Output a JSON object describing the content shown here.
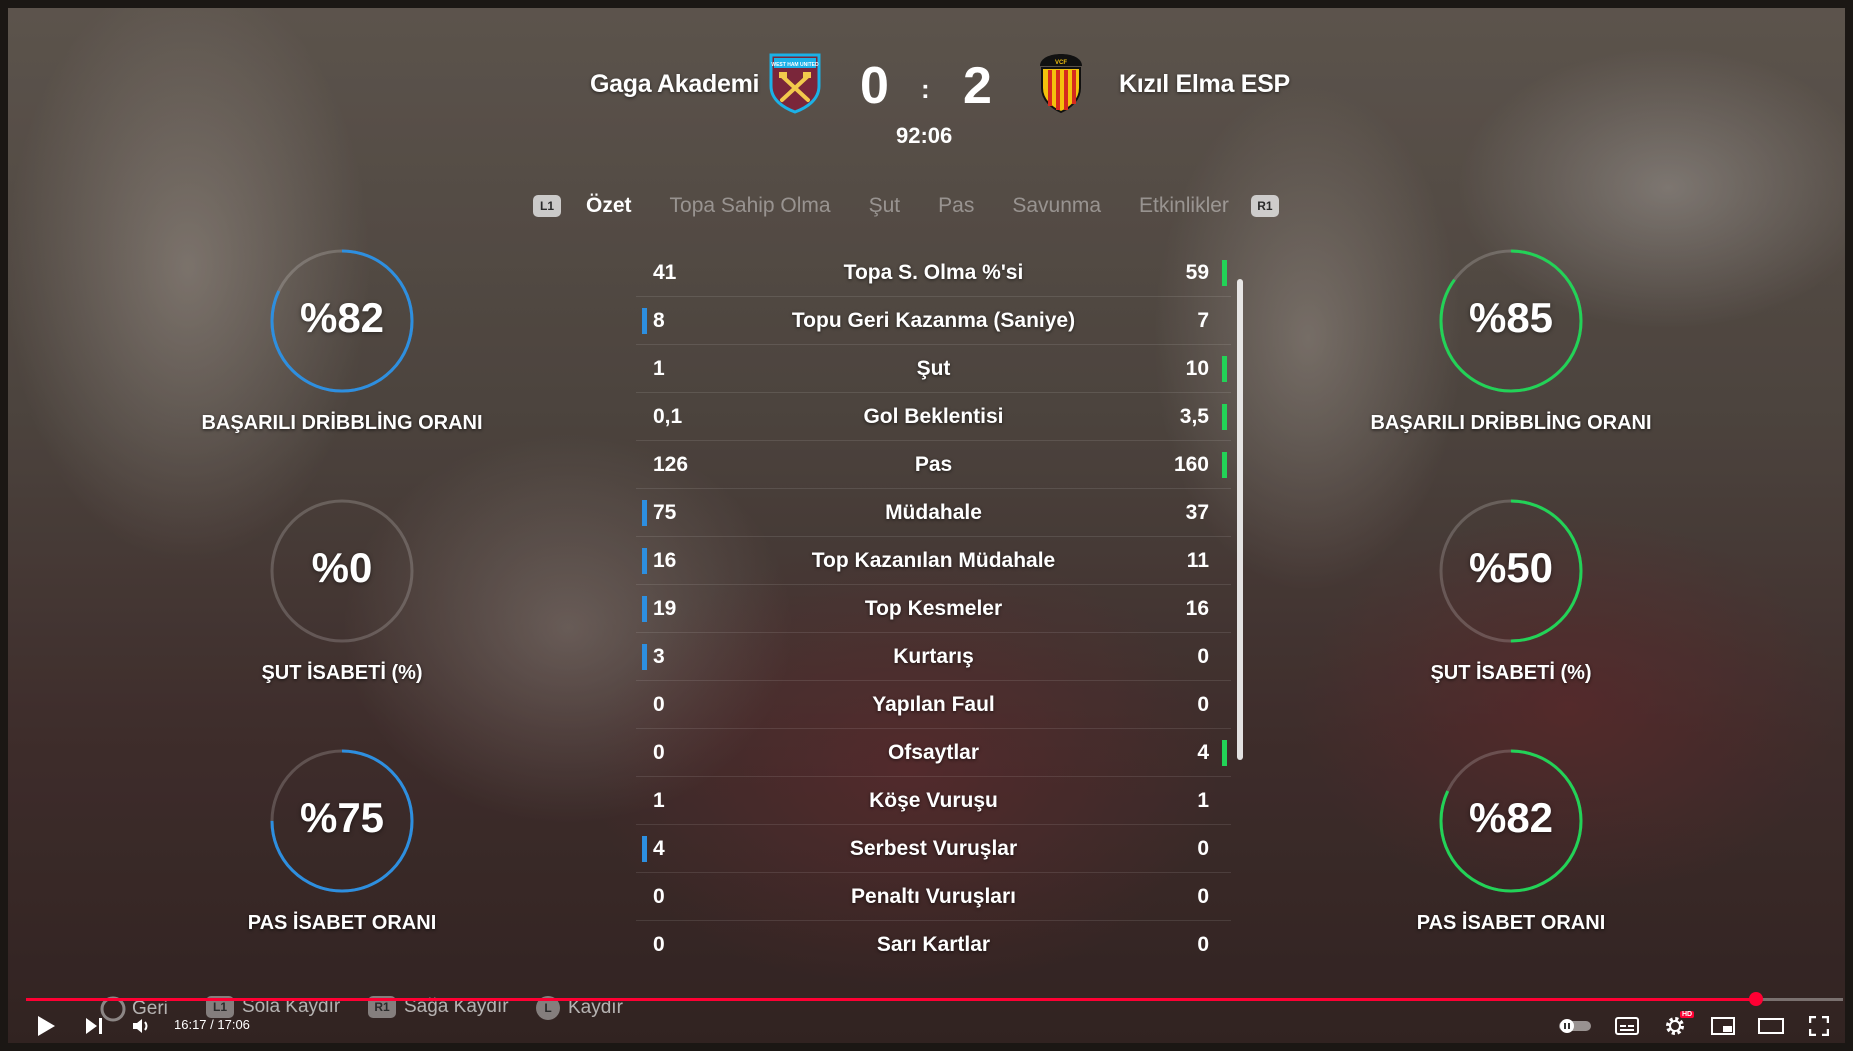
{
  "match": {
    "home_team": "Gaga Akademi",
    "away_team": "Kızıl Elma ESP",
    "home_score": "0",
    "away_score": "2",
    "separator": ":",
    "clock": "92:06",
    "home_crest_text": "WEST HAM UNITED",
    "away_crest_text": "VCF"
  },
  "tabs": {
    "left_button": "L1",
    "right_button": "R1",
    "items": [
      "Özet",
      "Topa Sahip Olma",
      "Şut",
      "Pas",
      "Savunma",
      "Etkinlikler"
    ],
    "active_index": 0
  },
  "home_rings": [
    {
      "value": "%82",
      "fraction": 0.82,
      "label": "BAŞARILI DRİBBLİNG ORANI"
    },
    {
      "value": "%0",
      "fraction": 0.0,
      "label": "ŞUT İSABETİ (%)"
    },
    {
      "value": "%75",
      "fraction": 0.75,
      "label": "PAS İSABET ORANI"
    }
  ],
  "away_rings": [
    {
      "value": "%85",
      "fraction": 0.85,
      "label": "BAŞARILI DRİBBLİNG ORANI"
    },
    {
      "value": "%50",
      "fraction": 0.5,
      "label": "ŞUT İSABETİ (%)"
    },
    {
      "value": "%82",
      "fraction": 0.82,
      "label": "PAS İSABET ORANI"
    }
  ],
  "stats": [
    {
      "label": "Topa S. Olma %'si",
      "home": "41",
      "away": "59",
      "leader": "away"
    },
    {
      "label": "Topu Geri Kazanma (Saniye)",
      "home": "8",
      "away": "7",
      "leader": "home"
    },
    {
      "label": "Şut",
      "home": "1",
      "away": "10",
      "leader": "away"
    },
    {
      "label": "Gol Beklentisi",
      "home": "0,1",
      "away": "3,5",
      "leader": "away"
    },
    {
      "label": "Pas",
      "home": "126",
      "away": "160",
      "leader": "away"
    },
    {
      "label": "Müdahale",
      "home": "75",
      "away": "37",
      "leader": "home"
    },
    {
      "label": "Top Kazanılan Müdahale",
      "home": "16",
      "away": "11",
      "leader": "home"
    },
    {
      "label": "Top Kesmeler",
      "home": "19",
      "away": "16",
      "leader": "home"
    },
    {
      "label": "Kurtarış",
      "home": "3",
      "away": "0",
      "leader": "home"
    },
    {
      "label": "Yapılan Faul",
      "home": "0",
      "away": "0",
      "leader": "none"
    },
    {
      "label": "Ofsaytlar",
      "home": "0",
      "away": "4",
      "leader": "away"
    },
    {
      "label": "Köşe Vuruşu",
      "home": "1",
      "away": "1",
      "leader": "none"
    },
    {
      "label": "Serbest Vuruşlar",
      "home": "4",
      "away": "0",
      "leader": "home"
    },
    {
      "label": "Penaltı Vuruşları",
      "home": "0",
      "away": "0",
      "leader": "none"
    },
    {
      "label": "Sarı Kartlar",
      "home": "0",
      "away": "0",
      "leader": "none"
    }
  ],
  "hints": [
    {
      "button": "O",
      "label": "Geri"
    },
    {
      "button": "L1",
      "label": "Sola Kaydır"
    },
    {
      "button": "R1",
      "label": "Sağa Kaydır"
    },
    {
      "button": "L",
      "label": "Kaydır"
    }
  ],
  "player": {
    "time": "16:17 / 17:06",
    "progress": 0.952,
    "hd_badge": "HD"
  },
  "colors": {
    "home_accent": "#2d8fe0",
    "away_accent": "#22d357",
    "progress_red": "#ff0033"
  }
}
